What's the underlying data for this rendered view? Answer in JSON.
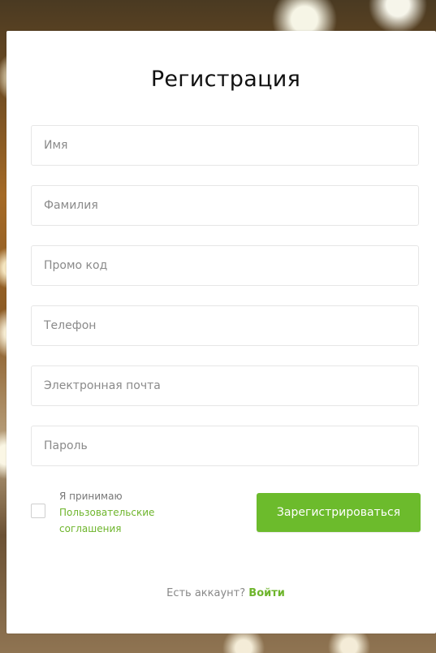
{
  "form": {
    "title": "Регистрация",
    "fields": [
      {
        "placeholder": "Имя",
        "value": ""
      },
      {
        "placeholder": "Фамилия",
        "value": ""
      },
      {
        "placeholder": "Промо код",
        "value": ""
      },
      {
        "placeholder": "Телефон",
        "value": ""
      },
      {
        "placeholder": "Электронная почта",
        "value": ""
      },
      {
        "placeholder": "Пароль",
        "value": ""
      }
    ],
    "agreement": {
      "prefix": "Я принимаю",
      "link_label": "Пользовательские соглашения",
      "checked": false
    },
    "submit_label": "Зарегистрироваться",
    "account_prompt": "Есть аккаунт?",
    "login_label": "Войти"
  },
  "colors": {
    "accent": "#6cbb2c",
    "link": "#6eb52c"
  }
}
